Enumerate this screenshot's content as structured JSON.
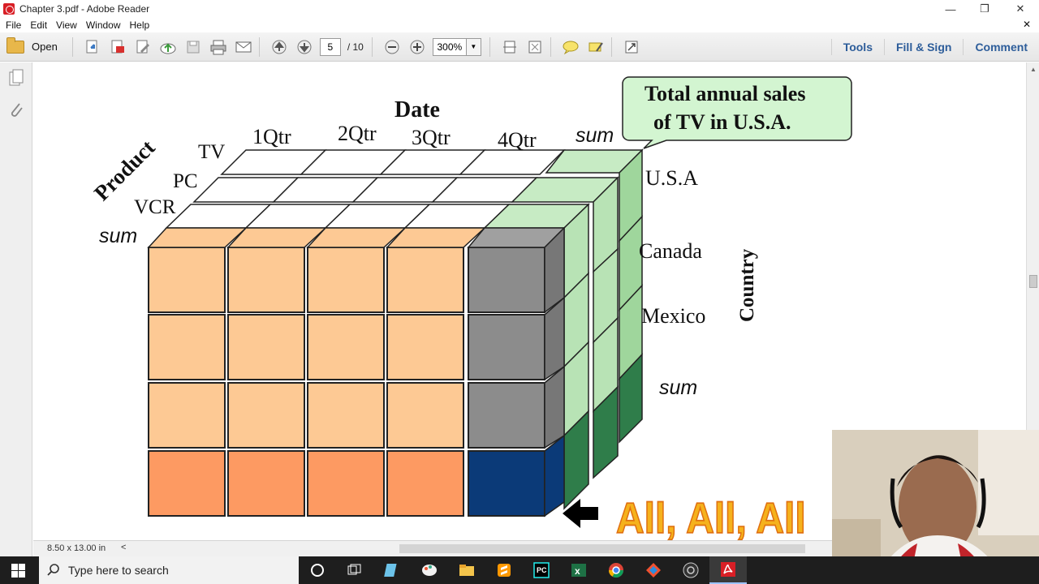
{
  "window": {
    "title": "Chapter 3.pdf - Adobe Reader",
    "minimize": "—",
    "restore": "❐",
    "close": "✕"
  },
  "menu": [
    "File",
    "Edit",
    "View",
    "Window",
    "Help"
  ],
  "menu_close": "✕",
  "toolbar": {
    "open_label": "Open",
    "page_current": "5",
    "page_total": "/ 10",
    "zoom": "300%"
  },
  "right_tabs": [
    "Tools",
    "Fill & Sign",
    "Comment"
  ],
  "slide": {
    "date_label": "Date",
    "product_label": "Product",
    "country_label": "Country",
    "quarters": [
      "1Qtr",
      "2Qtr",
      "3Qtr",
      "4Qtr"
    ],
    "sum_top": "sum",
    "products": [
      "TV",
      "PC",
      "VCR"
    ],
    "sum_product": "sum",
    "countries": [
      "U.S.A",
      "Canada",
      "Mexico"
    ],
    "sum_country": "sum",
    "callout": "Total annual sales of  TV in U.S.A.",
    "all_text": "All, All, All",
    "colors": {
      "orange_light": "#fdc994",
      "orange_dark": "#fd9a62",
      "gray": "#8c8c8c",
      "green_light": "#a8dba8",
      "green_dark": "#2f7d4a",
      "navy": "#0b3a78"
    }
  },
  "status": {
    "page_size": "8.50 x 13.00 in",
    "collapse": "<"
  },
  "taskbar": {
    "search_placeholder": "Type here to search"
  }
}
